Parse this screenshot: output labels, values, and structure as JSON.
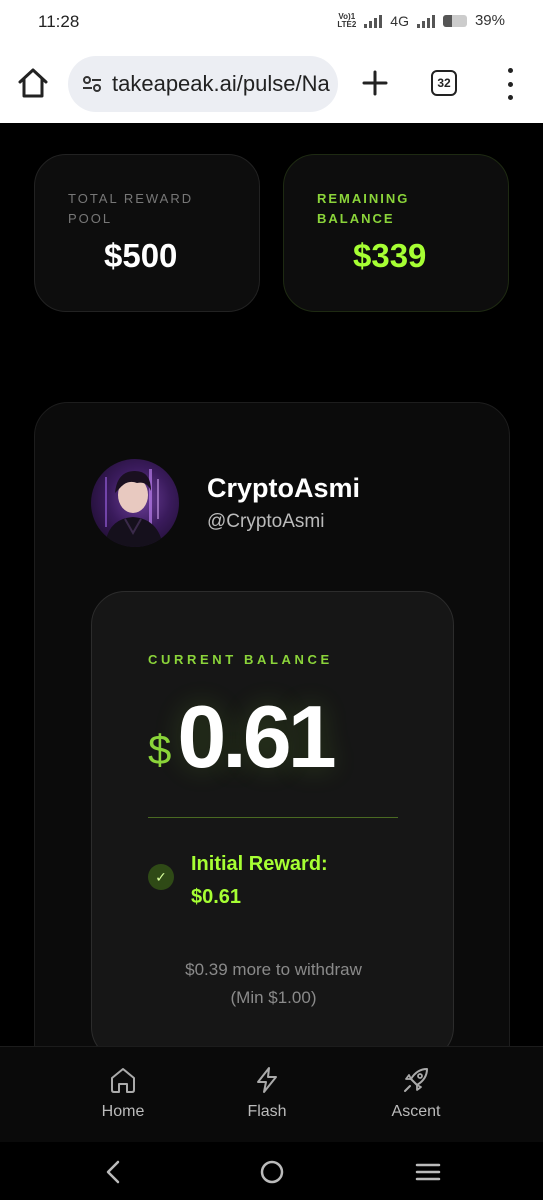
{
  "status_bar": {
    "time": "11:28",
    "volte_line1": "Vo)1",
    "volte_line2": "LTE2",
    "network": "4G",
    "battery": "39%",
    "battery_level": 0.39
  },
  "browser": {
    "url": "takeapeak.ai/pulse/Na",
    "tab_count": "32"
  },
  "stats": {
    "total_label": "TOTAL REWARD POOL",
    "total_value": "$500",
    "remaining_label": "REMAINING BALANCE",
    "remaining_value": "$339"
  },
  "profile": {
    "name": "CryptoAsmi",
    "handle": "@CryptoAsmi"
  },
  "balance": {
    "label": "CURRENT BALANCE",
    "currency": "$",
    "value": "0.61",
    "reward_line1": "Initial Reward:",
    "reward_line2": "$0.61",
    "withdraw_line1": "$0.39 more to withdraw",
    "withdraw_line2": "(Min $1.00)"
  },
  "nav": {
    "items": [
      {
        "label": "Home",
        "icon": "home-icon"
      },
      {
        "label": "Flash",
        "icon": "flash-icon"
      },
      {
        "label": "Ascent",
        "icon": "rocket-icon"
      }
    ]
  },
  "colors": {
    "accent": "#a6ff33",
    "accent_dim": "#8bd43a",
    "background": "#000000",
    "card": "#161616"
  }
}
